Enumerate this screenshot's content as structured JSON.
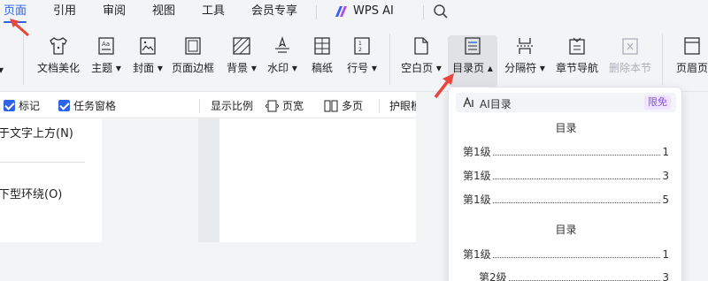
{
  "menu": {
    "tabs": [
      {
        "label": "页面",
        "active": true
      },
      {
        "label": "引用"
      },
      {
        "label": "审阅"
      },
      {
        "label": "视图"
      },
      {
        "label": "工具"
      },
      {
        "label": "会员专享"
      }
    ],
    "wps_ai": "WPS AI",
    "accent": "#2f63e6"
  },
  "ribbon": {
    "partial_left": "▾",
    "buttons": [
      {
        "label": "文档美化",
        "icon": "shirt-icon"
      },
      {
        "label": "主题",
        "icon": "theme-icon"
      },
      {
        "label": "封面",
        "icon": "cover-icon"
      },
      {
        "label": "页面边框",
        "icon": "page-border-icon"
      },
      {
        "label": "背景",
        "icon": "background-icon"
      },
      {
        "label": "水印",
        "icon": "watermark-icon"
      },
      {
        "label": "稿纸",
        "icon": "grid-paper-icon"
      },
      {
        "label": "行号",
        "icon": "line-number-icon"
      },
      {
        "label": "空白页",
        "icon": "blank-page-icon"
      },
      {
        "label": "目录页",
        "icon": "toc-page-icon"
      },
      {
        "label": "分隔符",
        "icon": "separator-icon"
      },
      {
        "label": "章节导航",
        "icon": "section-nav-icon"
      },
      {
        "label": "删除本节",
        "icon": "delete-section-icon"
      },
      {
        "label": "页眉页",
        "icon": "header-icon"
      }
    ]
  },
  "subbar": {
    "mark": "标记",
    "task_pane": "任务窗格",
    "display_ratio": "显示比例",
    "page_width": "页宽",
    "multi_page": "多页",
    "eye_care": "护眼模"
  },
  "left_panel": {
    "option_above": "于文字上方(N)",
    "option_wrap": "下型环绕(O)"
  },
  "dropdown": {
    "ai_label": "AI目录",
    "badge": "限免",
    "samples": [
      {
        "title": "目录",
        "entries": [
          {
            "label": "第1级",
            "page": "1",
            "level": 1
          },
          {
            "label": "第1级",
            "page": "3",
            "level": 1
          },
          {
            "label": "第1级",
            "page": "5",
            "level": 1
          }
        ]
      },
      {
        "title": "目录",
        "entries": [
          {
            "label": "第1级",
            "page": "1",
            "level": 1
          },
          {
            "label": "第2级",
            "page": "3",
            "level": 2
          }
        ]
      }
    ]
  }
}
